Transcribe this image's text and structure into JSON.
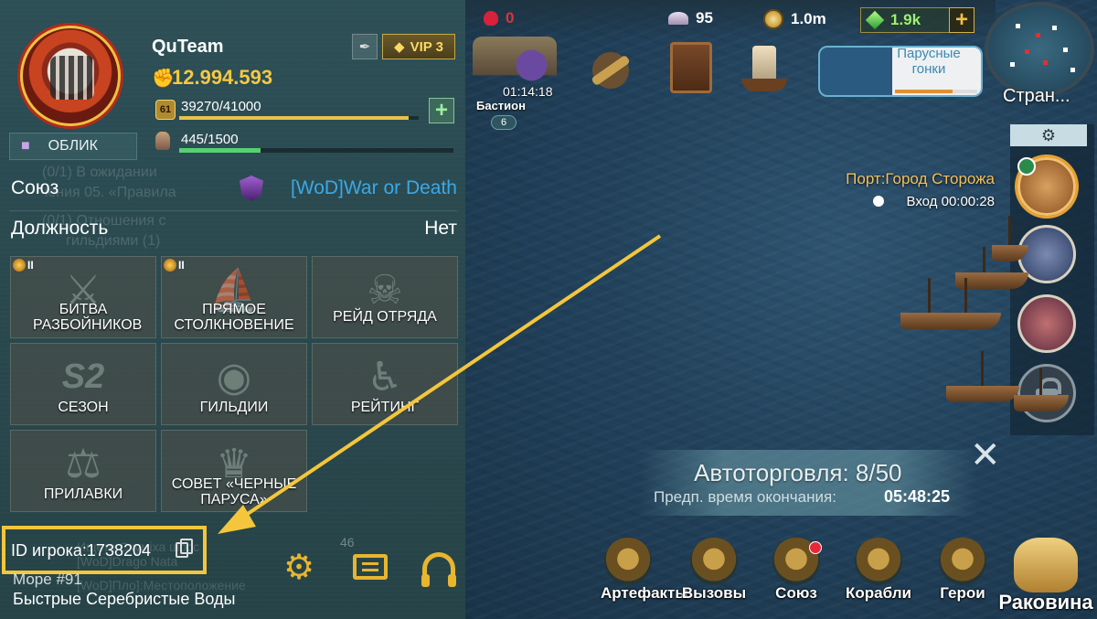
{
  "profile": {
    "name": "QuTeam",
    "vip": "VIP 3",
    "power": "12.994.593",
    "level": "61",
    "xp": "39270/41000",
    "xp_fraction": 0.958,
    "crew": "445/1500",
    "crew_fraction": 0.297,
    "skin_label": "ОБЛИК"
  },
  "ghost_text": {
    "line1": "(0/1) В ожидании",
    "line2": "чения 05. «Правила",
    "line3": "(0/1) Отношения с",
    "line4": "гильдиями (1)",
    "line5": "Ищете Скуміха шосс",
    "line6": "[WoD]Drago Nata",
    "line7": "[WoD]Пло]:Местоположение"
  },
  "alliance": {
    "label": "Союз",
    "value": "[WoD]War or Death",
    "value_color": "#3aa8e8"
  },
  "position": {
    "label": "Должность",
    "value": "Нет"
  },
  "tiles": [
    {
      "label": "БИТВА РАЗБОЙНИКОВ",
      "tier": "II",
      "icon": "crossed-swords-icon"
    },
    {
      "label": "ПРЯМОЕ СТОЛКНОВЕНИЕ",
      "tier": "II",
      "icon": "ship-icon"
    },
    {
      "label": "РЕЙД ОТРЯДА",
      "tier": "",
      "icon": "skull-icon"
    },
    {
      "label": "СЕЗОН",
      "tier": "",
      "icon": "season-s2-icon",
      "art": "S2"
    },
    {
      "label": "ГИЛЬДИИ",
      "tier": "",
      "icon": "guild-icon"
    },
    {
      "label": "РЕЙТИНГ",
      "tier": "",
      "icon": "trophy-icon"
    },
    {
      "label": "ПРИЛАВКИ",
      "tier": "",
      "icon": "scales-icon"
    },
    {
      "label": "СОВЕТ «ЧЕРНЫЕ ПАРУСА»",
      "tier": "",
      "icon": "black-sails-icon"
    }
  ],
  "player_id": "ID игрока:1738204",
  "bottom_num": "46",
  "sea": "Море #91",
  "location": "Быстрые Серебристые Воды",
  "resources": {
    "skull": "0",
    "shells": "95",
    "coins": "1.0m",
    "gems": "1.9k"
  },
  "minimap_label": "Стран...",
  "events": {
    "bastion_timer": "01:14:18",
    "bastion_name": "Бастион",
    "bastion_level": "6",
    "regatta": "Парусные гонки"
  },
  "port": {
    "name": "Порт:Город Сторожа",
    "entry": "Вход 00:00:28"
  },
  "autotrade": {
    "title": "Автоторговля: 8/50",
    "eta_label": "Предп. время окончания:",
    "eta": "05:48:25"
  },
  "dock": {
    "artifacts": "Артефакты",
    "challenges": "Вызовы",
    "alliance": "Союз",
    "ships": "Корабли",
    "heroes": "Герои",
    "shells": "Раковина"
  },
  "colors": {
    "accent_gold": "#f5c842",
    "highlight": "#f3c63c",
    "xp_bar": "#e8c24a",
    "crew_bar": "#57d071"
  }
}
